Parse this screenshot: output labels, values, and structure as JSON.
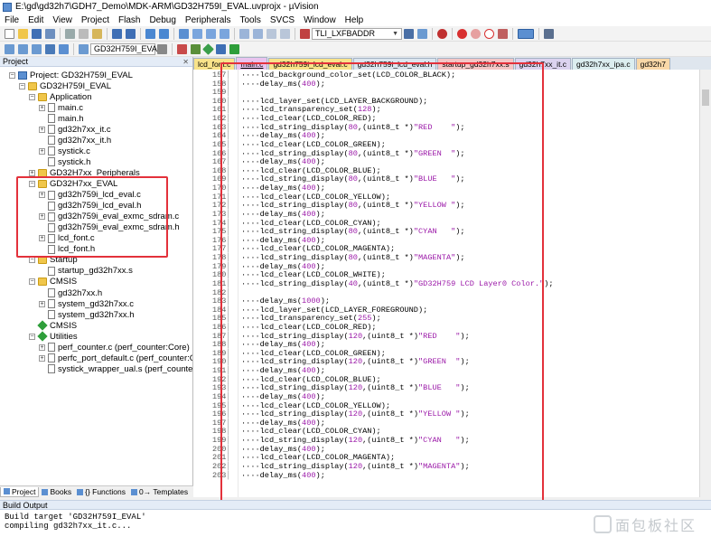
{
  "title_bar": "E:\\gd\\gd32h7\\GDH7_Demo\\MDK-ARM\\GD32H759I_EVAL.uvprojx - µVision",
  "menu": [
    "File",
    "Edit",
    "View",
    "Project",
    "Flash",
    "Debug",
    "Peripherals",
    "Tools",
    "SVCS",
    "Window",
    "Help"
  ],
  "toolbar": {
    "find_combo": "TLI_LXFBADDR",
    "target_combo": "GD32H759I_EVAL"
  },
  "project_panel": {
    "title": "Project",
    "tree": [
      {
        "label": "Project: GD32H759I_EVAL",
        "type": "target",
        "indent": 0,
        "expander": "−"
      },
      {
        "label": "GD32H759I_EVAL",
        "type": "folder",
        "indent": 1,
        "expander": "−"
      },
      {
        "label": "Application",
        "type": "folder",
        "indent": 2,
        "expander": "−"
      },
      {
        "label": "main.c",
        "type": "file",
        "indent": 3,
        "expander": "+"
      },
      {
        "label": "main.h",
        "type": "file",
        "indent": 3,
        "expander": ""
      },
      {
        "label": "gd32h7xx_it.c",
        "type": "file",
        "indent": 3,
        "expander": "+"
      },
      {
        "label": "gd32h7xx_it.h",
        "type": "file",
        "indent": 3,
        "expander": ""
      },
      {
        "label": "systick.c",
        "type": "file",
        "indent": 3,
        "expander": "+"
      },
      {
        "label": "systick.h",
        "type": "file",
        "indent": 3,
        "expander": ""
      },
      {
        "label": "GD32H7xx_Peripherals",
        "type": "folder",
        "indent": 2,
        "expander": "+"
      },
      {
        "label": "GD32H7xx_EVAL",
        "type": "folder",
        "indent": 2,
        "expander": "−"
      },
      {
        "label": "gd32h759i_lcd_eval.c",
        "type": "file",
        "indent": 3,
        "expander": "+"
      },
      {
        "label": "gd32h759i_lcd_eval.h",
        "type": "file",
        "indent": 3,
        "expander": ""
      },
      {
        "label": "gd32h759i_eval_exmc_sdram.c",
        "type": "file",
        "indent": 3,
        "expander": "+"
      },
      {
        "label": "gd32h759i_eval_exmc_sdram.h",
        "type": "file",
        "indent": 3,
        "expander": ""
      },
      {
        "label": "lcd_font.c",
        "type": "file",
        "indent": 3,
        "expander": "+"
      },
      {
        "label": "lcd_font.h",
        "type": "file",
        "indent": 3,
        "expander": ""
      },
      {
        "label": "Startup",
        "type": "folder",
        "indent": 2,
        "expander": "−"
      },
      {
        "label": "startup_gd32h7xx.s",
        "type": "file",
        "indent": 3,
        "expander": ""
      },
      {
        "label": "CMSIS",
        "type": "folder",
        "indent": 2,
        "expander": "−"
      },
      {
        "label": "gd32h7xx.h",
        "type": "file",
        "indent": 3,
        "expander": ""
      },
      {
        "label": "system_gd32h7xx.c",
        "type": "file",
        "indent": 3,
        "expander": "+"
      },
      {
        "label": "system_gd32h7xx.h",
        "type": "file",
        "indent": 3,
        "expander": ""
      },
      {
        "label": "CMSIS",
        "type": "gem",
        "indent": 2,
        "expander": ""
      },
      {
        "label": "Utilities",
        "type": "gem",
        "indent": 2,
        "expander": "−"
      },
      {
        "label": "perf_counter.c (perf_counter:Core)",
        "type": "file",
        "indent": 3,
        "expander": "+"
      },
      {
        "label": "perfc_port_default.c (perf_counter:Core)",
        "type": "file",
        "indent": 3,
        "expander": "+"
      },
      {
        "label": "systick_wrapper_ual.s (perf_counter:Core)",
        "type": "file",
        "indent": 3,
        "expander": ""
      }
    ],
    "bottom_tabs": [
      "Project",
      "Books",
      "{} Functions",
      "0→ Templates"
    ]
  },
  "editor": {
    "tabs": [
      {
        "label": "lcd_font.c",
        "color": "#f9e38a"
      },
      {
        "label": "main.c",
        "color": "#e9c4ef",
        "active": true
      },
      {
        "label": "gd32h759i_lcd_eval.c",
        "color": "#f9e38a"
      },
      {
        "label": "gd32h759i_lcd_eval.h",
        "color": "#dce6ef"
      },
      {
        "label": "startup_gd32h7xx.s",
        "color": "#f4c6c6"
      },
      {
        "label": "gd32h7xx_it.c",
        "color": "#dcd3ef"
      },
      {
        "label": "gd32h7xx_ipa.c",
        "color": "#dceef0"
      },
      {
        "label": "gd32h7",
        "color": "#f9d8a8"
      }
    ],
    "lines": [
      {
        "n": "157",
        "code": "    lcd_background_color_set(LCD_COLOR_BLACK);"
      },
      {
        "n": "158",
        "code": "    delay_ms(400);"
      },
      {
        "n": "159",
        "code": ""
      },
      {
        "n": "160",
        "code": "    lcd_layer_set(LCD_LAYER_BACKGROUND);"
      },
      {
        "n": "161",
        "code": "    lcd_transparency_set(128);"
      },
      {
        "n": "162",
        "code": "    lcd_clear(LCD_COLOR_RED);"
      },
      {
        "n": "163",
        "code": "    lcd_string_display(80,(uint8_t *)\"RED    \");"
      },
      {
        "n": "164",
        "code": "    delay_ms(400);"
      },
      {
        "n": "165",
        "code": "    lcd_clear(LCD_COLOR_GREEN);"
      },
      {
        "n": "166",
        "code": "    lcd_string_display(80,(uint8_t *)\"GREEN  \");"
      },
      {
        "n": "167",
        "code": "    delay_ms(400);"
      },
      {
        "n": "168",
        "code": "    lcd_clear(LCD_COLOR_BLUE);"
      },
      {
        "n": "169",
        "code": "    lcd_string_display(80,(uint8_t *)\"BLUE   \");"
      },
      {
        "n": "170",
        "code": "    delay_ms(400);"
      },
      {
        "n": "171",
        "code": "    lcd_clear(LCD_COLOR_YELLOW);"
      },
      {
        "n": "172",
        "code": "    lcd_string_display(80,(uint8_t *)\"YELLOW \");"
      },
      {
        "n": "173",
        "code": "    delay_ms(400);"
      },
      {
        "n": "174",
        "code": "    lcd_clear(LCD_COLOR_CYAN);"
      },
      {
        "n": "175",
        "code": "    lcd_string_display(80,(uint8_t *)\"CYAN   \");"
      },
      {
        "n": "176",
        "code": "    delay_ms(400);"
      },
      {
        "n": "177",
        "code": "    lcd_clear(LCD_COLOR_MAGENTA);"
      },
      {
        "n": "178",
        "code": "    lcd_string_display(80,(uint8_t *)\"MAGENTA\");"
      },
      {
        "n": "179",
        "code": "    delay_ms(400);"
      },
      {
        "n": "180",
        "code": "    lcd_clear(LCD_COLOR_WHITE);"
      },
      {
        "n": "181",
        "code": "    lcd_string_display(40,(uint8_t *)\"GD32H759 LCD Layer0 Color.\");"
      },
      {
        "n": "182",
        "code": ""
      },
      {
        "n": "183",
        "code": "    delay_ms(1000);"
      },
      {
        "n": "184",
        "code": "    lcd_layer_set(LCD_LAYER_FOREGROUND);"
      },
      {
        "n": "185",
        "code": "    lcd_transparency_set(255);"
      },
      {
        "n": "186",
        "code": "    lcd_clear(LCD_COLOR_RED);"
      },
      {
        "n": "187",
        "code": "    lcd_string_display(120,(uint8_t *)\"RED    \");"
      },
      {
        "n": "188",
        "code": "    delay_ms(400);"
      },
      {
        "n": "189",
        "code": "    lcd_clear(LCD_COLOR_GREEN);"
      },
      {
        "n": "190",
        "code": "    lcd_string_display(120,(uint8_t *)\"GREEN  \");"
      },
      {
        "n": "191",
        "code": "    delay_ms(400);"
      },
      {
        "n": "192",
        "code": "    lcd_clear(LCD_COLOR_BLUE);"
      },
      {
        "n": "193",
        "code": "    lcd_string_display(120,(uint8_t *)\"BLUE   \");"
      },
      {
        "n": "194",
        "code": "    delay_ms(400);"
      },
      {
        "n": "195",
        "code": "    lcd_clear(LCD_COLOR_YELLOW);"
      },
      {
        "n": "196",
        "code": "    lcd_string_display(120,(uint8_t *)\"YELLOW \");"
      },
      {
        "n": "197",
        "code": "    delay_ms(400);"
      },
      {
        "n": "198",
        "code": "    lcd_clear(LCD_COLOR_CYAN);"
      },
      {
        "n": "199",
        "code": "    lcd_string_display(120,(uint8_t *)\"CYAN   \");"
      },
      {
        "n": "200",
        "code": "    delay_ms(400);"
      },
      {
        "n": "201",
        "code": "    lcd_clear(LCD_COLOR_MAGENTA);"
      },
      {
        "n": "202",
        "code": "    lcd_string_display(120,(uint8_t *)\"MAGENTA\");"
      },
      {
        "n": "203",
        "code": "    delay_ms(400);"
      }
    ]
  },
  "build_output": {
    "title": "Build Output",
    "lines": [
      "Build target 'GD32H759I_EVAL'",
      "compiling gd32h7xx_it.c..."
    ]
  },
  "watermark": "面包板社区",
  "colors": {
    "highlight_box": "#e3313b",
    "keyword_string": "#9b19a8"
  }
}
